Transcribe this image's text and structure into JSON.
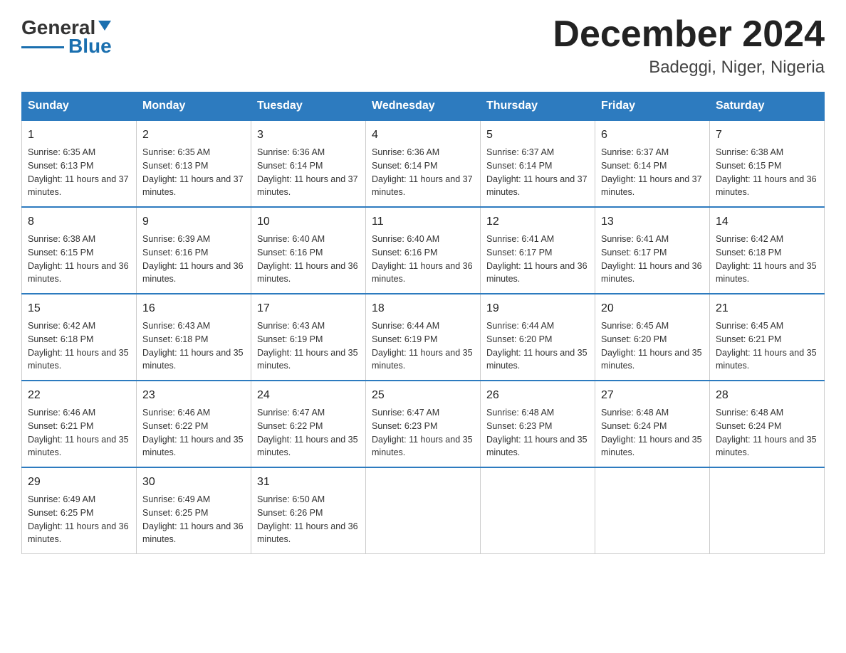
{
  "logo": {
    "text_general": "General",
    "text_blue": "Blue"
  },
  "title": "December 2024",
  "subtitle": "Badeggi, Niger, Nigeria",
  "days_of_week": [
    "Sunday",
    "Monday",
    "Tuesday",
    "Wednesday",
    "Thursday",
    "Friday",
    "Saturday"
  ],
  "weeks": [
    [
      {
        "day": "1",
        "sunrise": "6:35 AM",
        "sunset": "6:13 PM",
        "daylight": "11 hours and 37 minutes."
      },
      {
        "day": "2",
        "sunrise": "6:35 AM",
        "sunset": "6:13 PM",
        "daylight": "11 hours and 37 minutes."
      },
      {
        "day": "3",
        "sunrise": "6:36 AM",
        "sunset": "6:14 PM",
        "daylight": "11 hours and 37 minutes."
      },
      {
        "day": "4",
        "sunrise": "6:36 AM",
        "sunset": "6:14 PM",
        "daylight": "11 hours and 37 minutes."
      },
      {
        "day": "5",
        "sunrise": "6:37 AM",
        "sunset": "6:14 PM",
        "daylight": "11 hours and 37 minutes."
      },
      {
        "day": "6",
        "sunrise": "6:37 AM",
        "sunset": "6:14 PM",
        "daylight": "11 hours and 37 minutes."
      },
      {
        "day": "7",
        "sunrise": "6:38 AM",
        "sunset": "6:15 PM",
        "daylight": "11 hours and 36 minutes."
      }
    ],
    [
      {
        "day": "8",
        "sunrise": "6:38 AM",
        "sunset": "6:15 PM",
        "daylight": "11 hours and 36 minutes."
      },
      {
        "day": "9",
        "sunrise": "6:39 AM",
        "sunset": "6:16 PM",
        "daylight": "11 hours and 36 minutes."
      },
      {
        "day": "10",
        "sunrise": "6:40 AM",
        "sunset": "6:16 PM",
        "daylight": "11 hours and 36 minutes."
      },
      {
        "day": "11",
        "sunrise": "6:40 AM",
        "sunset": "6:16 PM",
        "daylight": "11 hours and 36 minutes."
      },
      {
        "day": "12",
        "sunrise": "6:41 AM",
        "sunset": "6:17 PM",
        "daylight": "11 hours and 36 minutes."
      },
      {
        "day": "13",
        "sunrise": "6:41 AM",
        "sunset": "6:17 PM",
        "daylight": "11 hours and 36 minutes."
      },
      {
        "day": "14",
        "sunrise": "6:42 AM",
        "sunset": "6:18 PM",
        "daylight": "11 hours and 35 minutes."
      }
    ],
    [
      {
        "day": "15",
        "sunrise": "6:42 AM",
        "sunset": "6:18 PM",
        "daylight": "11 hours and 35 minutes."
      },
      {
        "day": "16",
        "sunrise": "6:43 AM",
        "sunset": "6:18 PM",
        "daylight": "11 hours and 35 minutes."
      },
      {
        "day": "17",
        "sunrise": "6:43 AM",
        "sunset": "6:19 PM",
        "daylight": "11 hours and 35 minutes."
      },
      {
        "day": "18",
        "sunrise": "6:44 AM",
        "sunset": "6:19 PM",
        "daylight": "11 hours and 35 minutes."
      },
      {
        "day": "19",
        "sunrise": "6:44 AM",
        "sunset": "6:20 PM",
        "daylight": "11 hours and 35 minutes."
      },
      {
        "day": "20",
        "sunrise": "6:45 AM",
        "sunset": "6:20 PM",
        "daylight": "11 hours and 35 minutes."
      },
      {
        "day": "21",
        "sunrise": "6:45 AM",
        "sunset": "6:21 PM",
        "daylight": "11 hours and 35 minutes."
      }
    ],
    [
      {
        "day": "22",
        "sunrise": "6:46 AM",
        "sunset": "6:21 PM",
        "daylight": "11 hours and 35 minutes."
      },
      {
        "day": "23",
        "sunrise": "6:46 AM",
        "sunset": "6:22 PM",
        "daylight": "11 hours and 35 minutes."
      },
      {
        "day": "24",
        "sunrise": "6:47 AM",
        "sunset": "6:22 PM",
        "daylight": "11 hours and 35 minutes."
      },
      {
        "day": "25",
        "sunrise": "6:47 AM",
        "sunset": "6:23 PM",
        "daylight": "11 hours and 35 minutes."
      },
      {
        "day": "26",
        "sunrise": "6:48 AM",
        "sunset": "6:23 PM",
        "daylight": "11 hours and 35 minutes."
      },
      {
        "day": "27",
        "sunrise": "6:48 AM",
        "sunset": "6:24 PM",
        "daylight": "11 hours and 35 minutes."
      },
      {
        "day": "28",
        "sunrise": "6:48 AM",
        "sunset": "6:24 PM",
        "daylight": "11 hours and 35 minutes."
      }
    ],
    [
      {
        "day": "29",
        "sunrise": "6:49 AM",
        "sunset": "6:25 PM",
        "daylight": "11 hours and 36 minutes."
      },
      {
        "day": "30",
        "sunrise": "6:49 AM",
        "sunset": "6:25 PM",
        "daylight": "11 hours and 36 minutes."
      },
      {
        "day": "31",
        "sunrise": "6:50 AM",
        "sunset": "6:26 PM",
        "daylight": "11 hours and 36 minutes."
      },
      null,
      null,
      null,
      null
    ]
  ]
}
